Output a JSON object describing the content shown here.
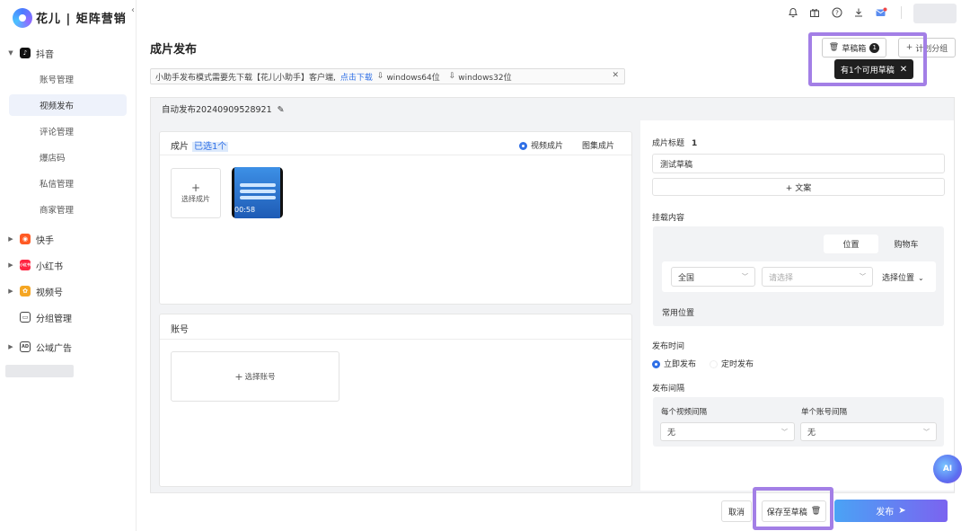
{
  "brand": {
    "logo_text": "花儿 | 矩阵营销"
  },
  "sidebar": {
    "douyin": "抖音",
    "douyin_sub": [
      "账号管理",
      "视频发布",
      "评论管理",
      "爆店码",
      "私信管理",
      "商家管理"
    ],
    "kuaishou": "快手",
    "xiaohongshu": "小红书",
    "xiaohongshu_icon_text": "小红书",
    "shipinhao": "视频号",
    "group_mgmt": "分组管理",
    "public_ads": "公域广告",
    "ads_icon_text": "AD"
  },
  "page": {
    "title": "成片发布"
  },
  "notice": {
    "text": "小助手发布模式需要先下载【花儿小助手】客户端,",
    "link": "点击下载",
    "dl64": "windows64位",
    "dl32": "windows32位",
    "close": "✕"
  },
  "draft": {
    "label": "草稿箱",
    "count": "1",
    "plan_label": "计划分组",
    "tooltip": "有1个可用草稿"
  },
  "task": {
    "name": "自动发布20240909528921"
  },
  "clips": {
    "header": "成片",
    "selected": "已选1个",
    "mode_video": "视频成片",
    "mode_image": "图集成片",
    "add_label": "选择成片",
    "add_plus": "+",
    "thumb_duration": "00:58"
  },
  "account": {
    "header": "账号",
    "select_label": "选择账号"
  },
  "right": {
    "title_label": "成片标题",
    "title_count": "1",
    "title_value": "测试草稿",
    "add_copy": "+ 文案",
    "mount_label": "挂载内容",
    "tab_location": "位置",
    "tab_cart": "购物车",
    "region": "全国",
    "region_placeholder": "请选择",
    "location_select": "选择位置",
    "frequent": "常用位置",
    "publish_time_label": "发布时间",
    "now": "立即发布",
    "scheduled": "定时发布",
    "interval_label": "发布间隔",
    "per_video_label": "每个视频间隔",
    "per_video_value": "无",
    "per_account_label": "单个账号间隔",
    "per_account_value": "无"
  },
  "footer": {
    "cancel": "取消",
    "save_draft": "保存至草稿",
    "publish": "发布"
  },
  "ai_button": "AI",
  "colors": {
    "accent": "#2f6fe6",
    "highlight": "#a37fe6",
    "publish_start": "#4aa3f5",
    "publish_end": "#7b63f0"
  }
}
